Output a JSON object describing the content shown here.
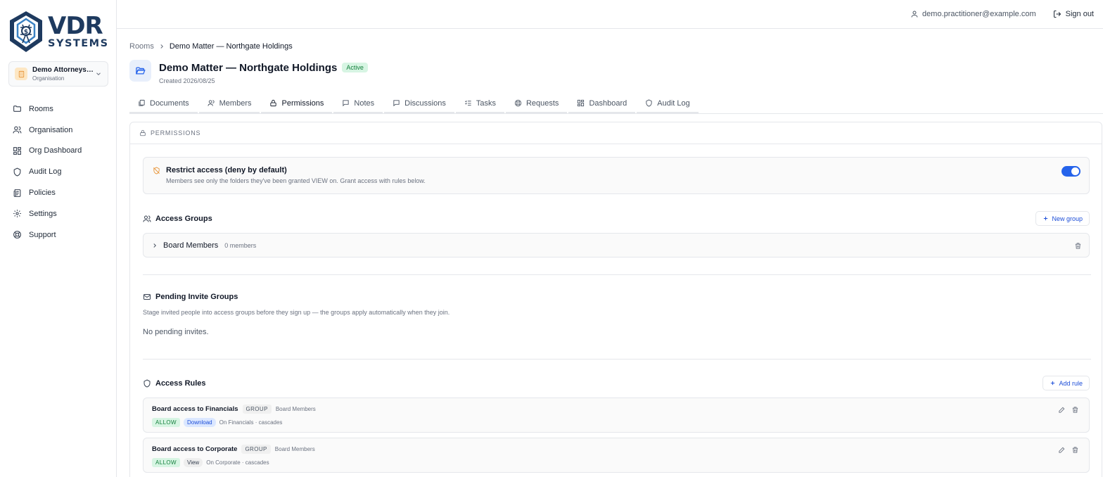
{
  "brand": {
    "line1": "VDR",
    "line2": "SYSTEMS"
  },
  "org": {
    "name": "Demo Attorneys Inc.",
    "type": "Organisation"
  },
  "nav": [
    {
      "label": "Rooms",
      "icon": "folder-icon"
    },
    {
      "label": "Organisation",
      "icon": "users-icon"
    },
    {
      "label": "Org Dashboard",
      "icon": "grid-icon"
    },
    {
      "label": "Audit Log",
      "icon": "shield-icon"
    },
    {
      "label": "Policies",
      "icon": "scroll-icon"
    },
    {
      "label": "Settings",
      "icon": "gear-icon"
    },
    {
      "label": "Support",
      "icon": "lifebuoy-icon"
    }
  ],
  "header": {
    "user_email": "demo.practitioner@example.com",
    "signout_label": "Sign out"
  },
  "breadcrumb": {
    "root": "Rooms",
    "current": "Demo Matter — Northgate Holdings"
  },
  "room": {
    "title": "Demo Matter — Northgate Holdings",
    "status": "Active",
    "created": "Created 2026/08/25"
  },
  "tabs": [
    {
      "label": "Documents",
      "icon": "documents-icon"
    },
    {
      "label": "Members",
      "icon": "user-icon"
    },
    {
      "label": "Permissions",
      "icon": "lock-icon",
      "active": true
    },
    {
      "label": "Notes",
      "icon": "note-icon"
    },
    {
      "label": "Discussions",
      "icon": "chat-icon"
    },
    {
      "label": "Tasks",
      "icon": "checklist-icon"
    },
    {
      "label": "Requests",
      "icon": "lifebuoy-icon"
    },
    {
      "label": "Dashboard",
      "icon": "grid-icon"
    },
    {
      "label": "Audit Log",
      "icon": "shield-icon"
    }
  ],
  "permissions": {
    "header": "PERMISSIONS",
    "restrict": {
      "title": "Restrict access (deny by default)",
      "description": "Members see only the folders they've been granted VIEW on. Grant access with rules below.",
      "enabled": true
    },
    "access_groups": {
      "title": "Access Groups",
      "new_label": "New group",
      "groups": [
        {
          "name": "Board Members",
          "count": "0 members"
        }
      ]
    },
    "pending": {
      "title": "Pending Invite Groups",
      "description": "Stage invited people into access groups before they sign up — the groups apply automatically when they join.",
      "empty": "No pending invites."
    },
    "rules": {
      "title": "Access Rules",
      "add_label": "Add rule",
      "items": [
        {
          "name": "Board access to Financials",
          "kind": "GROUP",
          "target": "Board Members",
          "effect": "ALLOW",
          "perm": "Download",
          "on": "On Financials · cascades"
        },
        {
          "name": "Board access to Corporate",
          "kind": "GROUP",
          "target": "Board Members",
          "effect": "ALLOW",
          "perm": "View",
          "on": "On Corporate · cascades"
        }
      ]
    }
  },
  "colors": {
    "accent": "#2563eb",
    "brand": "#1e3a5f",
    "success": "#15803d"
  }
}
